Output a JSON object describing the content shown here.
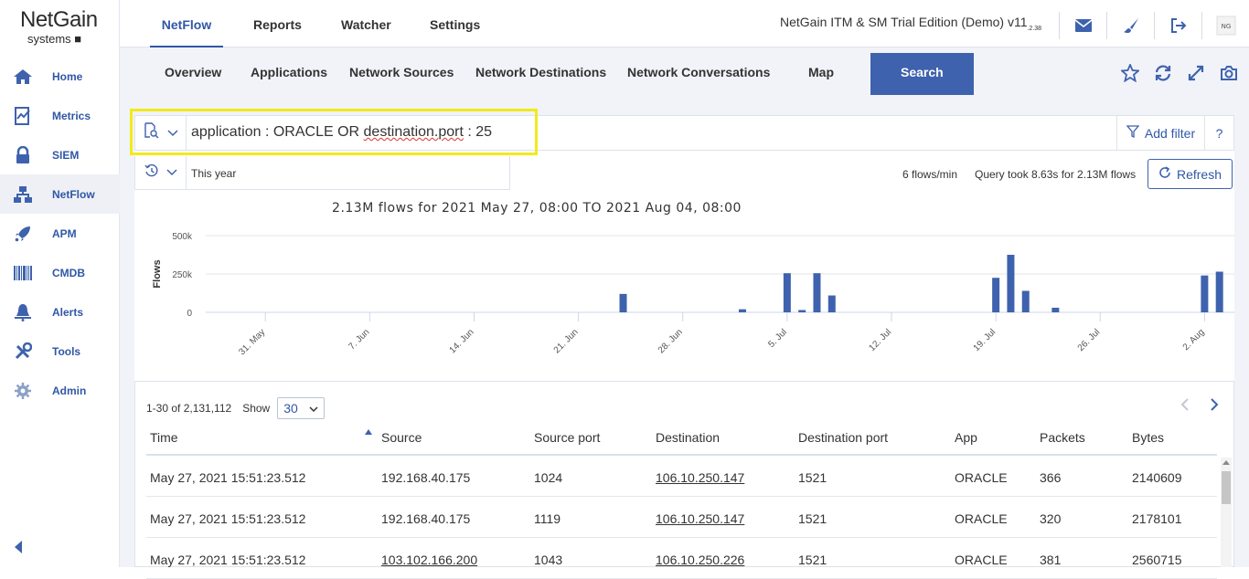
{
  "brand": {
    "name": "NetGain",
    "sub": "systems"
  },
  "sidebar": {
    "items": [
      {
        "label": "Home",
        "icon": "home-icon"
      },
      {
        "label": "Metrics",
        "icon": "metrics-icon"
      },
      {
        "label": "SIEM",
        "icon": "lock-icon"
      },
      {
        "label": "NetFlow",
        "icon": "network-icon",
        "active": true
      },
      {
        "label": "APM",
        "icon": "rocket-icon"
      },
      {
        "label": "CMDB",
        "icon": "barcode-icon"
      },
      {
        "label": "Alerts",
        "icon": "alert-icon"
      },
      {
        "label": "Tools",
        "icon": "tools-icon"
      },
      {
        "label": "Admin",
        "icon": "gear-icon"
      }
    ]
  },
  "topnav": {
    "tabs": [
      "NetFlow",
      "Reports",
      "Watcher",
      "Settings"
    ],
    "active": "NetFlow",
    "edition": "NetGain ITM & SM Trial Edition (Demo) v11",
    "edition_build": ".2.38"
  },
  "subnav": {
    "tabs": [
      "Overview",
      "Applications",
      "Network Sources",
      "Network Destinations",
      "Network Conversations",
      "Map",
      "Search"
    ],
    "active": "Search"
  },
  "search": {
    "query_prefix": "application : ORACLE OR ",
    "query_underlined": "destination.port",
    "query_suffix": " : 25",
    "add_filter_label": "Add filter",
    "help_label": "?"
  },
  "time": {
    "range_label": "This year"
  },
  "stats": {
    "rate": "6 flows/min",
    "query_time": "Query took 8.63s for 2.13M flows",
    "refresh_label": "Refresh"
  },
  "chart_data": {
    "type": "bar",
    "title": "2.13M flows for 2021 May 27, 08:00 TO 2021 Aug 04, 08:00",
    "ylabel": "Flows",
    "xlabel": "",
    "ylim": [
      0,
      500000
    ],
    "y_ticks": [
      "500k",
      "250k",
      "0"
    ],
    "x_ticks": [
      "31. May",
      "7. Jun",
      "14. Jun",
      "21. Jun",
      "28. Jun",
      "5. Jul",
      "12. Jul",
      "19. Jul",
      "26. Jul",
      "2. Aug"
    ],
    "x_domain": [
      "2021-05-27",
      "2021-08-04"
    ],
    "series": [
      {
        "x": [
          "2021-06-24",
          "2021-07-02",
          "2021-07-05",
          "2021-07-06",
          "2021-07-07",
          "2021-07-08",
          "2021-07-19",
          "2021-07-20",
          "2021-07-21",
          "2021-07-23",
          "2021-08-02",
          "2021-08-03"
        ],
        "values": [
          120000,
          20000,
          255000,
          15000,
          255000,
          110000,
          225000,
          375000,
          140000,
          30000,
          240000,
          265000
        ]
      }
    ],
    "bar_color": "#3e62ad"
  },
  "table": {
    "range": "1-30 of 2,131,112",
    "show_label": "Show",
    "page_size": "30",
    "columns": [
      "Time",
      "Source",
      "Source port",
      "Destination",
      "Destination port",
      "App",
      "Packets",
      "Bytes"
    ],
    "rows": [
      [
        "May 27, 2021 15:51:23.512",
        "192.168.40.175",
        "1024",
        "106.10.250.147",
        "1521",
        "ORACLE",
        "366",
        "2140609"
      ],
      [
        "May 27, 2021 15:51:23.512",
        "192.168.40.175",
        "1119",
        "106.10.250.147",
        "1521",
        "ORACLE",
        "320",
        "2178101"
      ],
      [
        "May 27, 2021 15:51:23.512",
        "103.102.166.200",
        "1043",
        "106.10.250.226",
        "1521",
        "ORACLE",
        "381",
        "2560715"
      ]
    ],
    "link_cols": {
      "source_row3": true
    }
  },
  "colors": {
    "accent": "#3057a6",
    "button": "#3e62ad",
    "highlight": "#f2ea1b",
    "bg": "#f1f3f8"
  }
}
